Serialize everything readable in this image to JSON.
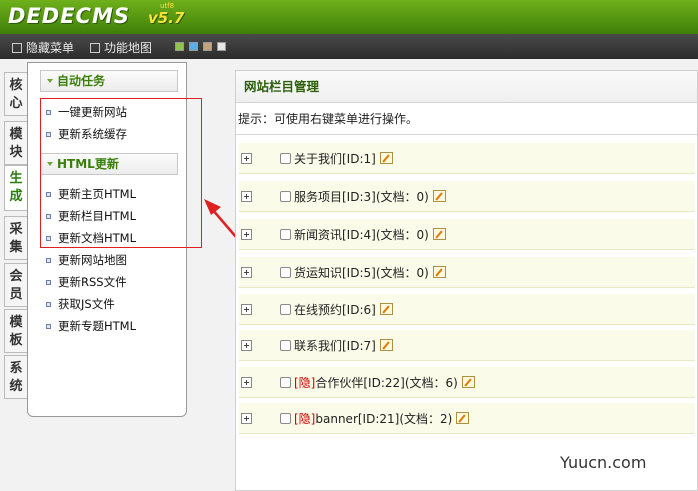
{
  "header": {
    "logo": "DEDECMS",
    "version": "v5.7",
    "version_sup": "utf8",
    "skin_colors": [
      "#8fc64a",
      "#5aaee3",
      "#c8a27a",
      "#e6e6e6"
    ]
  },
  "toolbar": {
    "hide_menu": "隐藏菜单",
    "function_map": "功能地图"
  },
  "tabs": [
    "核心",
    "模块",
    "生成",
    "采集",
    "会员",
    "模板",
    "系统"
  ],
  "active_tab": "生成",
  "menu": {
    "group1_title": "自动任务",
    "group1_items": [
      "一键更新网站",
      "更新系统缓存"
    ],
    "group2_title": "HTML更新",
    "group2_items": [
      "更新主页HTML",
      "更新栏目HTML",
      "更新文档HTML",
      "更新网站地图",
      "更新RSS文件",
      "获取JS文件",
      "更新专题HTML"
    ]
  },
  "content": {
    "title": "网站栏目管理",
    "tip": "提示：可使用右键菜单进行操作。",
    "rows": [
      {
        "prefix": "",
        "label": "关于我们[ID:1]"
      },
      {
        "prefix": "",
        "label": "服务项目[ID:3](文档：0)"
      },
      {
        "prefix": "",
        "label": "新闻资讯[ID:4](文档：0)"
      },
      {
        "prefix": "",
        "label": "货运知识[ID:5](文档：0)"
      },
      {
        "prefix": "",
        "label": "在线预约[ID:6]"
      },
      {
        "prefix": "",
        "label": "联系我们[ID:7]"
      },
      {
        "prefix": "[隐]",
        "label": "合作伙伴[ID:22](文档：6)"
      },
      {
        "prefix": "[隐]",
        "label": "banner[ID:21](文档：2)"
      }
    ]
  },
  "watermark": "Yuucn.com"
}
